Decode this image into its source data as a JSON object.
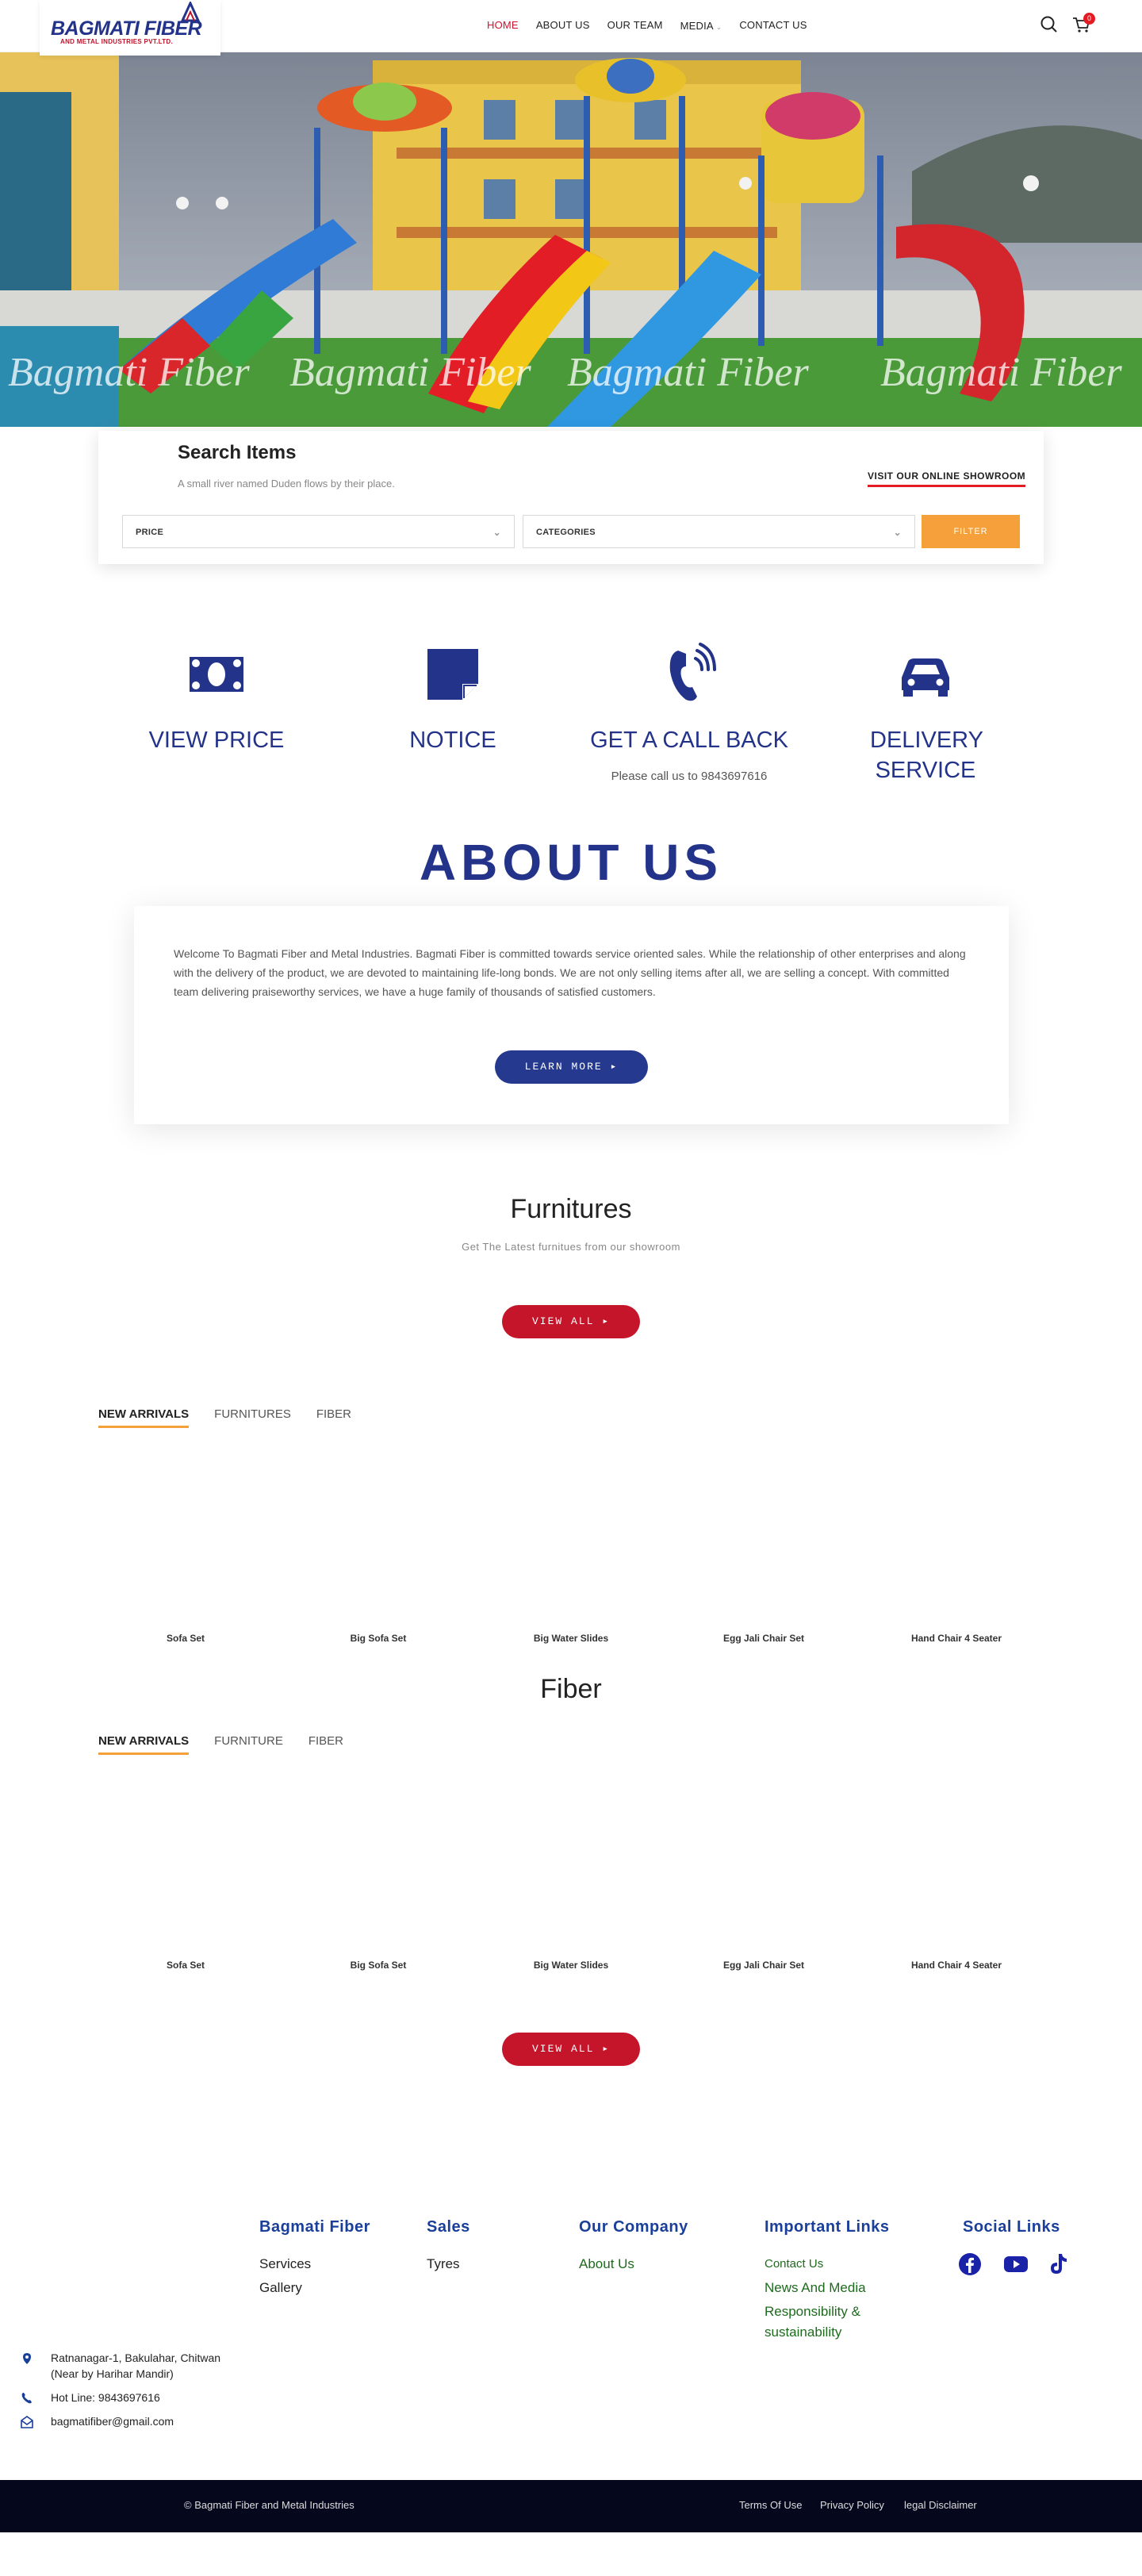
{
  "header": {
    "logo_text": "BAGMATI FIBER",
    "logo_sub": "AND METAL INDUSTRIES PVT.LTD.",
    "nav": [
      {
        "label": "HOME"
      },
      {
        "label": "ABOUT US"
      },
      {
        "label": "OUR TEAM"
      },
      {
        "label": "MEDIA"
      },
      {
        "label": "CONTACT US"
      }
    ],
    "cart_count": "0"
  },
  "hero": {
    "watermarks": [
      "Bagmati Fiber",
      "Bagmati Fiber",
      "Bagmati Fiber",
      "Bagmati Fiber"
    ]
  },
  "search": {
    "title": "Search Items",
    "subtitle": "A small river named Duden flows by their place.",
    "showroom_link": "VISIT OUR ONLINE SHOWROOM",
    "price_select": "PRICE",
    "categories_select": "CATEGORIES",
    "filter_label": "FILTER"
  },
  "features": [
    {
      "title": "VIEW PRICE",
      "desc": "",
      "icon": "money-icon"
    },
    {
      "title": "NOTICE",
      "desc": "",
      "icon": "note-icon"
    },
    {
      "title": "GET A CALL BACK",
      "desc": "Please call us to 9843697616",
      "icon": "phone-ring-icon"
    },
    {
      "title": "DELIVERY SERVICE",
      "desc": "",
      "icon": "car-icon"
    }
  ],
  "about": {
    "title": "ABOUT US",
    "text": "Welcome To Bagmati Fiber and Metal Industries. Bagmati Fiber is committed towards service oriented sales. While the relationship of other enterprises and along with the delivery of the product, we are devoted to maintaining life-long bonds. We are not only selling items after all, we are selling a concept. With committed team delivering praiseworthy services, we have a huge family of thousands of satisfied customers.",
    "button": "LEARN MORE"
  },
  "furnitures": {
    "title": "Furnitures",
    "subtitle": "Get The Latest furnitues from our showroom",
    "button": "VIEW ALL",
    "tabs": [
      "NEW ARRIVALS",
      "FURNITURES",
      "FIBER"
    ],
    "products": [
      "Sofa Set",
      "Big Sofa Set",
      "Big Water Slides",
      "Egg Jali Chair Set",
      "Hand Chair 4 Seater"
    ]
  },
  "fiber": {
    "title": "Fiber",
    "tabs": [
      "NEW ARRIVALS",
      "FURNITURE",
      "FIBER"
    ],
    "products": [
      "Sofa Set",
      "Big Sofa Set",
      "Big Water Slides",
      "Egg Jali Chair Set",
      "Hand Chair 4 Seater"
    ],
    "button": "VIEW ALL"
  },
  "footer": {
    "col1": {
      "heading": "Bagmati Fiber",
      "links": [
        "Services",
        "Gallery"
      ]
    },
    "col2": {
      "heading": "Sales",
      "links": [
        "Tyres"
      ]
    },
    "col3": {
      "heading": "Our Company",
      "links": [
        "About Us"
      ]
    },
    "col4": {
      "heading": "Important Links",
      "links": [
        "Contact Us",
        "News And Media",
        "Responsibility &",
        "sustainability"
      ]
    },
    "col5": {
      "heading": "Social Links"
    },
    "address_line1": "Ratnanagar-1, Bakulahar, Chitwan",
    "address_line2": "(Near by Harihar Mandir)",
    "hotline": "Hot Line: 9843697616",
    "email": "bagmatifiber@gmail.com",
    "copyright": "© Bagmati Fiber and Metal Industries",
    "legal": [
      "Terms Of Use",
      "Privacy Policy",
      "legal Disclaimer"
    ]
  },
  "colors": {
    "brand_blue": "#23338a",
    "brand_red": "#c4152a",
    "accent_orange": "#f5a03a",
    "footer_green": "#1e6b1e"
  }
}
